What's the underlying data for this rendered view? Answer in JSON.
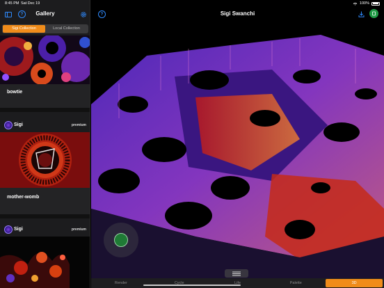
{
  "status_bar": {
    "time": "8:45 PM",
    "date": "Sat Dec 19",
    "battery": "100%"
  },
  "sidebar": {
    "title": "Gallery",
    "segments": [
      {
        "label": "Sigi Collection",
        "active": true
      },
      {
        "label": "Local Collection",
        "active": false
      }
    ],
    "cards": [
      {
        "name": "bowtie"
      },
      {
        "user": "Sigi",
        "tag": "premium",
        "name": "mother-womb"
      },
      {
        "user": "Sigi",
        "tag": "premium"
      }
    ]
  },
  "main": {
    "title": "Sigi Swanchi",
    "tabs": [
      {
        "label": "Render",
        "active": false
      },
      {
        "label": "Cycle",
        "active": false
      },
      {
        "label": "Life",
        "active": false
      },
      {
        "label": "Palette",
        "active": false
      },
      {
        "label": "3D",
        "active": true
      }
    ]
  },
  "colors": {
    "accent": "#f08c1a",
    "link": "#2f8bff",
    "record": "#1f9a45"
  }
}
